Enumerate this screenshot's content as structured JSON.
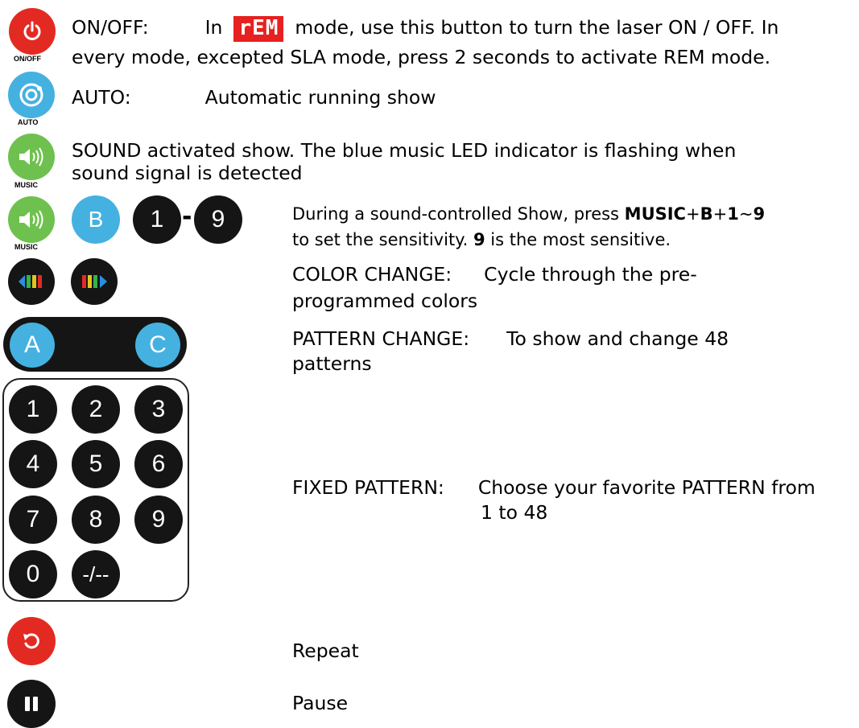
{
  "rows": {
    "onoff": {
      "label": "ON/OFF:",
      "in_word": "In",
      "rem_display": "rEM",
      "rest_line1": "mode, use this button to turn the laser ON / OFF. In",
      "line2": "every mode, excepted SLA mode, press 2 seconds to activate REM mode.",
      "caption": "ON/OFF"
    },
    "auto": {
      "label": "AUTO:",
      "desc": "Automatic running show",
      "caption": "AUTO"
    },
    "sound": {
      "line1": "SOUND activated show. The blue music LED indicator is flashing when",
      "line2": "sound signal is detected",
      "caption": "MUSIC"
    },
    "sensitivity": {
      "caption": "MUSIC",
      "key_b": "B",
      "key_1": "1",
      "dash": "-",
      "key_9": "9",
      "p1": "During a sound-controlled Show, press ",
      "b1": "MUSIC",
      "p2": "+",
      "b2": "B",
      "p3": "+",
      "b3": "1",
      "p4": "~",
      "b4": "9",
      "p5": "to set the sensitivity. ",
      "b5": "9",
      "p6": " is the most sensitive."
    },
    "color": {
      "label": "COLOR CHANGE:",
      "desc1": "Cycle through the pre-",
      "desc2": "programmed colors"
    },
    "pattern": {
      "key_a": "A",
      "key_c": "C",
      "label": "PATTERN CHANGE:",
      "desc1": "To show and change 48",
      "desc2": "patterns"
    },
    "fixed": {
      "label": "FIXED PATTERN:",
      "desc1": "Choose your favorite PATTERN from",
      "desc2": "1 to 48",
      "keys": [
        "1",
        "2",
        "3",
        "4",
        "5",
        "6",
        "7",
        "8",
        "9",
        "0",
        "-/--"
      ]
    },
    "repeat": {
      "desc": "Repeat"
    },
    "pause": {
      "desc": "Pause"
    }
  },
  "colors": {
    "red": "#e32a22",
    "blue": "#45b1e0",
    "green": "#6fc14f",
    "black": "#151515"
  }
}
